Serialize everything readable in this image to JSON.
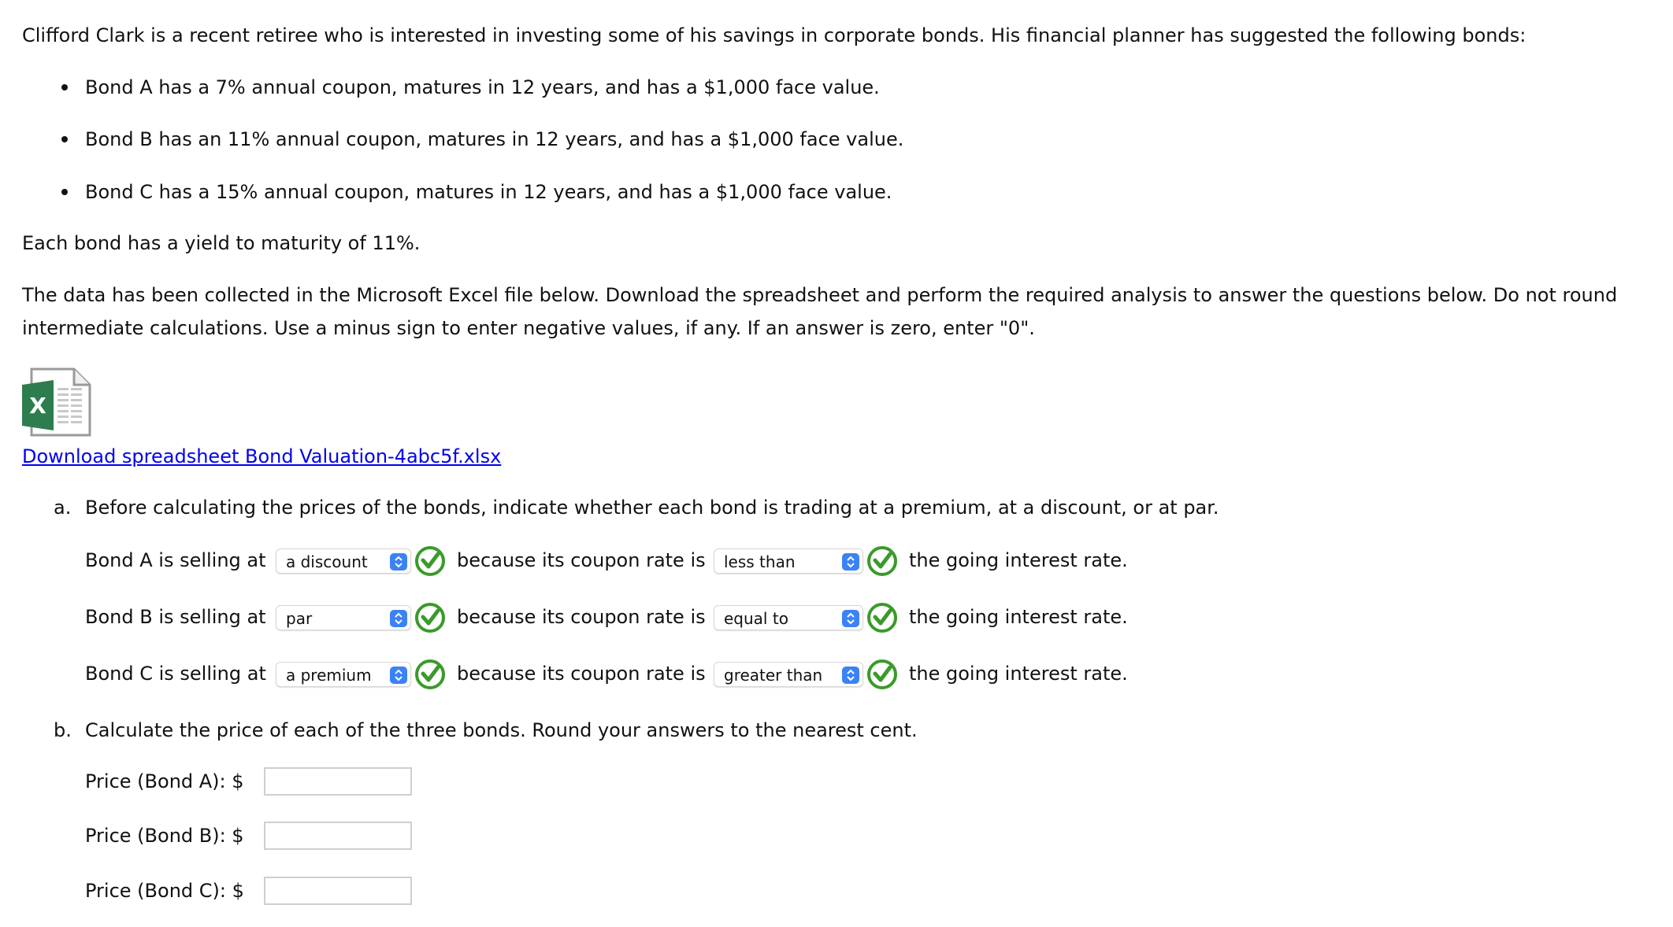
{
  "intro": {
    "text": "Clifford Clark is a recent retiree who is interested in investing some of his savings in corporate bonds. His financial planner has suggested the following bonds:"
  },
  "bonds": [
    {
      "text": "Bond A has a 7% annual coupon, matures in 12 years, and has a $1,000 face value."
    },
    {
      "text": "Bond B has an 11% annual coupon, matures in 12 years, and has a $1,000 face value."
    },
    {
      "text": "Bond C has a 15% annual coupon, matures in 12 years, and has a $1,000 face value."
    }
  ],
  "ytm_text": "Each bond has a yield to maturity of 11%.",
  "instructions": {
    "line1": "The data has been collected in the Microsoft Excel file below. Download the spreadsheet and perform the required analysis to answer the questions below. Do not round",
    "line2": "intermediate calculations. Use a minus sign to enter negative values, if any. If an answer is zero, enter \"0\"."
  },
  "download": {
    "icon": "excel-file-icon",
    "link_text": "Download spreadsheet Bond Valuation-4abc5f.xlsx"
  },
  "part_a": {
    "label": "a.",
    "question": "Before calculating the prices of the bonds, indicate whether each bond is trading at a premium, at a discount, or at par.",
    "middle_text": "because its coupon rate is",
    "end_text": "the going interest rate.",
    "rows": [
      {
        "prefix": "Bond A is selling at",
        "selling_value": "a discount",
        "comparison_value": "less than",
        "selling_correct": true,
        "comparison_correct": true
      },
      {
        "prefix": "Bond B is selling at",
        "selling_value": "par",
        "comparison_value": "equal to",
        "selling_correct": true,
        "comparison_correct": true
      },
      {
        "prefix": "Bond C is selling at",
        "selling_value": "a premium",
        "comparison_value": "greater than",
        "selling_correct": true,
        "comparison_correct": true
      }
    ]
  },
  "part_b": {
    "label": "b.",
    "question": "Calculate the price of each of the three bonds. Round your answers to the nearest cent.",
    "prices": [
      {
        "label": "Price (Bond A): $",
        "value": ""
      },
      {
        "label": "Price (Bond B): $",
        "value": ""
      },
      {
        "label": "Price (Bond C): $",
        "value": ""
      }
    ]
  },
  "colors": {
    "link": "#0000ee",
    "select_arrow": "#3b82f6",
    "check_green": "#3a9a2a",
    "excel_green": "#2e7d4f"
  }
}
